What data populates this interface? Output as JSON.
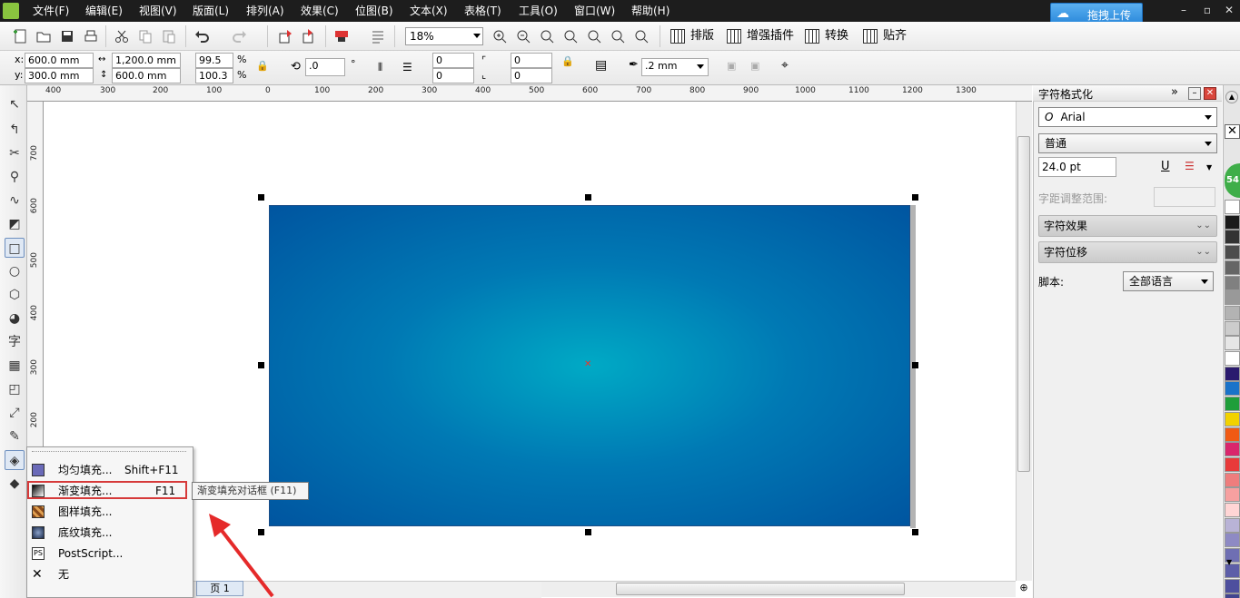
{
  "menu": {
    "items": [
      "文件(F)",
      "编辑(E)",
      "视图(V)",
      "版面(L)",
      "排列(A)",
      "效果(C)",
      "位图(B)",
      "文本(X)",
      "表格(T)",
      "工具(O)",
      "窗口(W)",
      "帮助(H)"
    ],
    "upload_button": "拖拽上传"
  },
  "toolbar": {
    "zoom": "18%",
    "plugins": [
      "排版",
      "增强插件",
      "转换",
      "贴齐"
    ]
  },
  "property_bar": {
    "x_label": "x:",
    "x": "600.0 mm",
    "y_label": "y:",
    "y": "300.0 mm",
    "width": "1,200.0 mm",
    "height": "600.0 mm",
    "scale_x": "99.5",
    "scale_y": "100.3",
    "percent": "%",
    "rotation": ".0",
    "degree": "°",
    "corner1": "0",
    "corner2": "0",
    "corner3": "0",
    "corner4": "0",
    "outline": ".2 mm"
  },
  "ruler": {
    "h_ticks": [
      "400",
      "300",
      "200",
      "100",
      "0",
      "100",
      "200",
      "300",
      "400",
      "500",
      "600",
      "700",
      "800",
      "900",
      "1000",
      "1100",
      "1200",
      "1300"
    ],
    "v_ticks": [
      "700",
      "600",
      "500",
      "400",
      "300",
      "200"
    ]
  },
  "toolbox": {
    "text_tool": "字"
  },
  "flyout": {
    "items": [
      {
        "label": "均匀填充...",
        "shortcut": "Shift+F11"
      },
      {
        "label": "渐变填充...",
        "shortcut": "F11"
      },
      {
        "label": "图样填充...",
        "shortcut": ""
      },
      {
        "label": "底纹填充...",
        "shortcut": ""
      },
      {
        "label": "PostScript...",
        "shortcut": ""
      },
      {
        "label": "无",
        "shortcut": ""
      }
    ],
    "tooltip": "渐变填充对话框 (F11)"
  },
  "page_tab": "页 1",
  "docker": {
    "title": "字符格式化",
    "font": "Arial",
    "style": "普通",
    "size": "24.0 pt",
    "spacing_label": "字距调整范围:",
    "sections": [
      "字符效果",
      "字符位移"
    ],
    "script_label": "脚本:",
    "script_value": "全部语言"
  },
  "palette": {
    "badge": "54",
    "colors": [
      "#ffffff",
      "#1a1a1a",
      "#333333",
      "#4d4d4d",
      "#666666",
      "#808080",
      "#999999",
      "#b3b3b3",
      "#cccccc",
      "#e6e6e6",
      "#ffffff",
      "#2a1a6e",
      "#1a73c9",
      "#1f9e3a",
      "#f2d200",
      "#f05a14",
      "#d9266c",
      "#e83a3a",
      "#ee7d7d",
      "#f6a0a0",
      "#ffd5d5",
      "#b9b3d6",
      "#8e8ac4",
      "#6f6fb3",
      "#5d5ea8",
      "#4e4f9e",
      "#42448f"
    ]
  }
}
